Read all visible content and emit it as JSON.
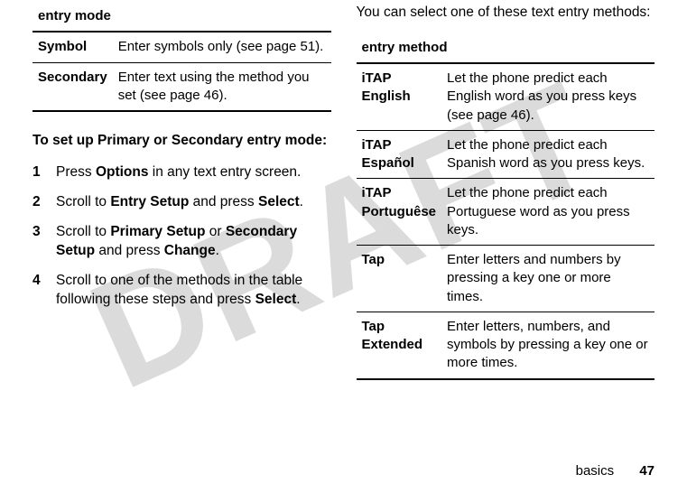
{
  "watermark": "DRAFT",
  "left": {
    "table_header": "entry mode",
    "rows": [
      {
        "name": "Symbol",
        "desc": "Enter symbols only (see page 51)."
      },
      {
        "name": "Secondary",
        "desc": "Enter text using the method you set (see page 46)."
      }
    ],
    "lead": "To set up Primary or Secondary entry mode:",
    "steps": [
      {
        "pre": "Press ",
        "b1": "Options",
        "post": " in any text entry screen."
      },
      {
        "pre": "Scroll to ",
        "b1": "Entry Setup",
        "mid": " and press ",
        "b2": "Select",
        "post": "."
      },
      {
        "pre": "Scroll to ",
        "b1": "Primary Setup",
        "mid": " or ",
        "b2": "Secondary Setup",
        "mid2": " and press ",
        "b3": "Change",
        "post": "."
      },
      {
        "pre": "Scroll to one of the methods in the table following these steps and press ",
        "b1": "Select",
        "post": "."
      }
    ]
  },
  "right": {
    "intro": "You can select one of these text entry methods:",
    "table_header": "entry method",
    "rows": [
      {
        "name": "iTAP English",
        "desc": "Let the phone predict each English word as you press keys (see page 46)."
      },
      {
        "name": "iTAP Español",
        "desc": "Let the phone predict each Spanish word as you press keys."
      },
      {
        "name": "iTAP Portuguêse",
        "desc": "Let the phone predict each Portuguese word as you press keys."
      },
      {
        "name": "Tap",
        "desc": "Enter letters and numbers by pressing a key one or more times."
      },
      {
        "name": "Tap Extended",
        "desc": "Enter letters, numbers, and symbols by pressing a key one or more times."
      }
    ]
  },
  "footer": {
    "section": "basics",
    "page": "47"
  }
}
